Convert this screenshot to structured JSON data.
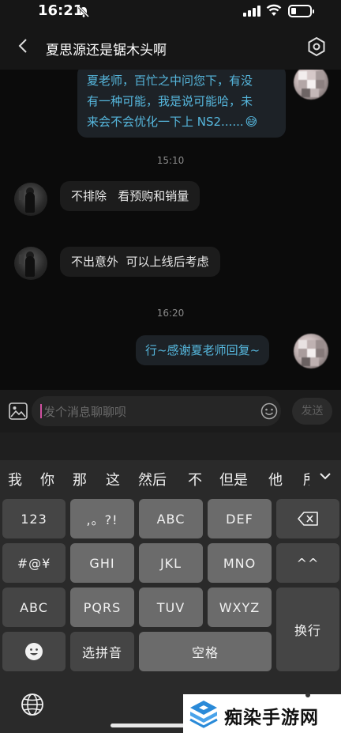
{
  "status_bar": {
    "time": "16:21"
  },
  "header": {
    "title": "夏思源还是锯木头啊"
  },
  "messages": [
    {
      "side": "out",
      "lines": [
        "夏老师，百忙之中问您下，有没",
        "有一种可能，我是说可能哈，未",
        "来会不会优化一下上 NS2......"
      ],
      "emoji": "😅"
    },
    {
      "type": "time",
      "text": "15:10"
    },
    {
      "side": "in",
      "text": "不排除   看预购和销量"
    },
    {
      "side": "in",
      "text": "不出意外  可以上线后考虑"
    },
    {
      "type": "time",
      "text": "16:20"
    },
    {
      "side": "out",
      "text": "行~感谢夏老师回复~"
    }
  ],
  "input": {
    "placeholder": "发个消息聊聊呗",
    "send_label": "发送"
  },
  "candidates": [
    "我",
    "你",
    "那",
    "这",
    "然后",
    "不",
    "但是",
    "他",
    "所"
  ],
  "keyboard": {
    "row1": [
      "123",
      ",。?!",
      "ABC",
      "DEF"
    ],
    "row2": [
      "#@¥",
      "GHI",
      "JKL",
      "MNO",
      "^^"
    ],
    "row3": [
      "ABC",
      "PQRS",
      "TUV",
      "WXYZ"
    ],
    "row4": [
      "选拼音",
      "空格"
    ],
    "enter": "换行"
  },
  "watermark": {
    "text": "痴染手游网"
  },
  "colors": {
    "outgoing_text": "#56b7dd",
    "background": "#0b0b0b",
    "watermark_logo": "#2a8ad8"
  }
}
